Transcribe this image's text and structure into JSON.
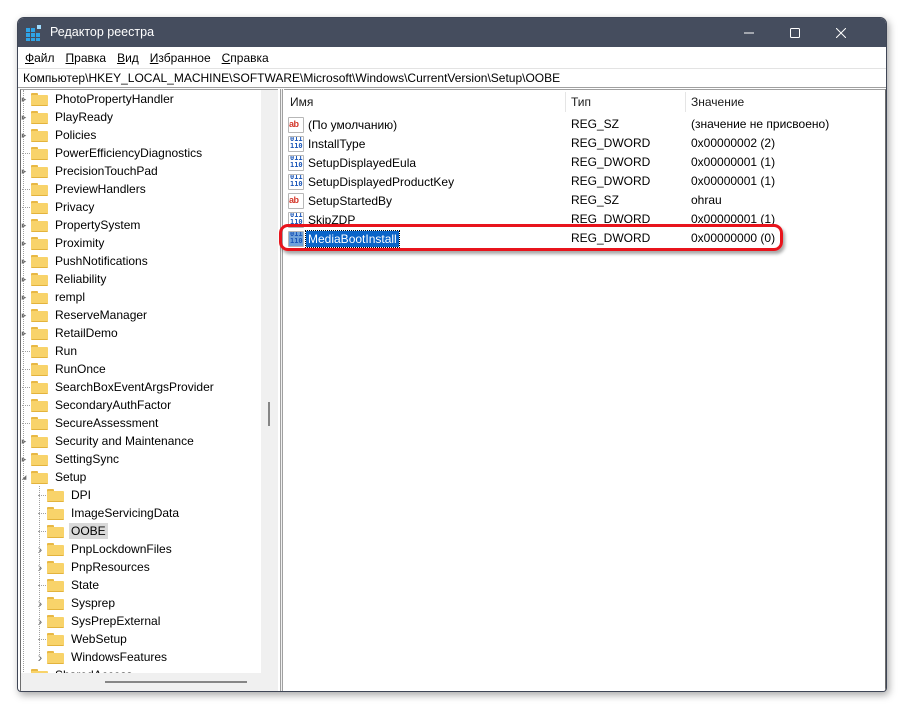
{
  "window": {
    "title": "Редактор реестра",
    "app_icon": "registry-editor-icon",
    "controls": {
      "minimize": "—",
      "maximize": "☐",
      "close": "✕"
    }
  },
  "menu": {
    "items": [
      {
        "label": "Файл",
        "accel": "Ф",
        "rest": "айл"
      },
      {
        "label": "Правка",
        "accel": "П",
        "rest": "равка"
      },
      {
        "label": "Вид",
        "accel": "В",
        "rest": "ид"
      },
      {
        "label": "Избранное",
        "accel": "И",
        "rest": "збранное"
      },
      {
        "label": "Справка",
        "accel": "С",
        "rest": "правка"
      }
    ]
  },
  "address": {
    "path": "Компьютер\\HKEY_LOCAL_MACHINE\\SOFTWARE\\Microsoft\\Windows\\CurrentVersion\\Setup\\OOBE"
  },
  "tree": {
    "items": [
      {
        "label": "PhotoPropertyHandler",
        "level": 0,
        "expander": "collapsed"
      },
      {
        "label": "PlayReady",
        "level": 0,
        "expander": "collapsed"
      },
      {
        "label": "Policies",
        "level": 0,
        "expander": "collapsed"
      },
      {
        "label": "PowerEfficiencyDiagnostics",
        "level": 0,
        "expander": "none"
      },
      {
        "label": "PrecisionTouchPad",
        "level": 0,
        "expander": "collapsed"
      },
      {
        "label": "PreviewHandlers",
        "level": 0,
        "expander": "none"
      },
      {
        "label": "Privacy",
        "level": 0,
        "expander": "none"
      },
      {
        "label": "PropertySystem",
        "level": 0,
        "expander": "collapsed"
      },
      {
        "label": "Proximity",
        "level": 0,
        "expander": "collapsed"
      },
      {
        "label": "PushNotifications",
        "level": 0,
        "expander": "collapsed"
      },
      {
        "label": "Reliability",
        "level": 0,
        "expander": "collapsed"
      },
      {
        "label": "rempl",
        "level": 0,
        "expander": "collapsed"
      },
      {
        "label": "ReserveManager",
        "level": 0,
        "expander": "collapsed"
      },
      {
        "label": "RetailDemo",
        "level": 0,
        "expander": "collapsed"
      },
      {
        "label": "Run",
        "level": 0,
        "expander": "none"
      },
      {
        "label": "RunOnce",
        "level": 0,
        "expander": "none"
      },
      {
        "label": "SearchBoxEventArgsProvider",
        "level": 0,
        "expander": "none"
      },
      {
        "label": "SecondaryAuthFactor",
        "level": 0,
        "expander": "none"
      },
      {
        "label": "SecureAssessment",
        "level": 0,
        "expander": "none"
      },
      {
        "label": "Security and Maintenance",
        "level": 0,
        "expander": "collapsed"
      },
      {
        "label": "SettingSync",
        "level": 0,
        "expander": "collapsed"
      },
      {
        "label": "Setup",
        "level": 0,
        "expander": "expanded"
      },
      {
        "label": "DPI",
        "level": 1,
        "expander": "none"
      },
      {
        "label": "ImageServicingData",
        "level": 1,
        "expander": "none"
      },
      {
        "label": "OOBE",
        "level": 1,
        "expander": "none",
        "selected": true
      },
      {
        "label": "PnpLockdownFiles",
        "level": 1,
        "expander": "collapsed"
      },
      {
        "label": "PnpResources",
        "level": 1,
        "expander": "collapsed"
      },
      {
        "label": "State",
        "level": 1,
        "expander": "none"
      },
      {
        "label": "Sysprep",
        "level": 1,
        "expander": "collapsed"
      },
      {
        "label": "SysPrepExternal",
        "level": 1,
        "expander": "collapsed"
      },
      {
        "label": "WebSetup",
        "level": 1,
        "expander": "none"
      },
      {
        "label": "WindowsFeatures",
        "level": 1,
        "expander": "collapsed"
      },
      {
        "label": "SharedAccess",
        "level": 0,
        "expander": "collapsed"
      }
    ]
  },
  "list": {
    "columns": {
      "name": "Имя",
      "type": "Тип",
      "value": "Значение"
    },
    "rows": [
      {
        "icon": "string-value-icon",
        "kind": "sz",
        "name": "(По умолчанию)",
        "type": "REG_SZ",
        "value": "(значение не присвоено)"
      },
      {
        "icon": "dword-value-icon",
        "kind": "dw",
        "name": "InstallType",
        "type": "REG_DWORD",
        "value": "0x00000002 (2)"
      },
      {
        "icon": "dword-value-icon",
        "kind": "dw",
        "name": "SetupDisplayedEula",
        "type": "REG_DWORD",
        "value": "0x00000001 (1)"
      },
      {
        "icon": "dword-value-icon",
        "kind": "dw",
        "name": "SetupDisplayedProductKey",
        "type": "REG_DWORD",
        "value": "0x00000001 (1)"
      },
      {
        "icon": "string-value-icon",
        "kind": "sz",
        "name": "SetupStartedBy",
        "type": "REG_SZ",
        "value": "ohrau"
      },
      {
        "icon": "dword-value-icon",
        "kind": "dw",
        "name": "SkipZDP",
        "type": "REG_DWORD",
        "value": "0x00000001 (1)"
      },
      {
        "icon": "dword-value-icon",
        "kind": "dw",
        "name": "MediaBootInstall",
        "type": "REG_DWORD",
        "value": "0x00000000 (0)",
        "selected": true
      }
    ]
  },
  "annotation": {
    "highlight_color": "#e8141c",
    "highlighted_row": "MediaBootInstall"
  },
  "colors": {
    "titlebar": "#454d5e",
    "selection": "#0a64c8",
    "folder": "#f8d36a"
  }
}
